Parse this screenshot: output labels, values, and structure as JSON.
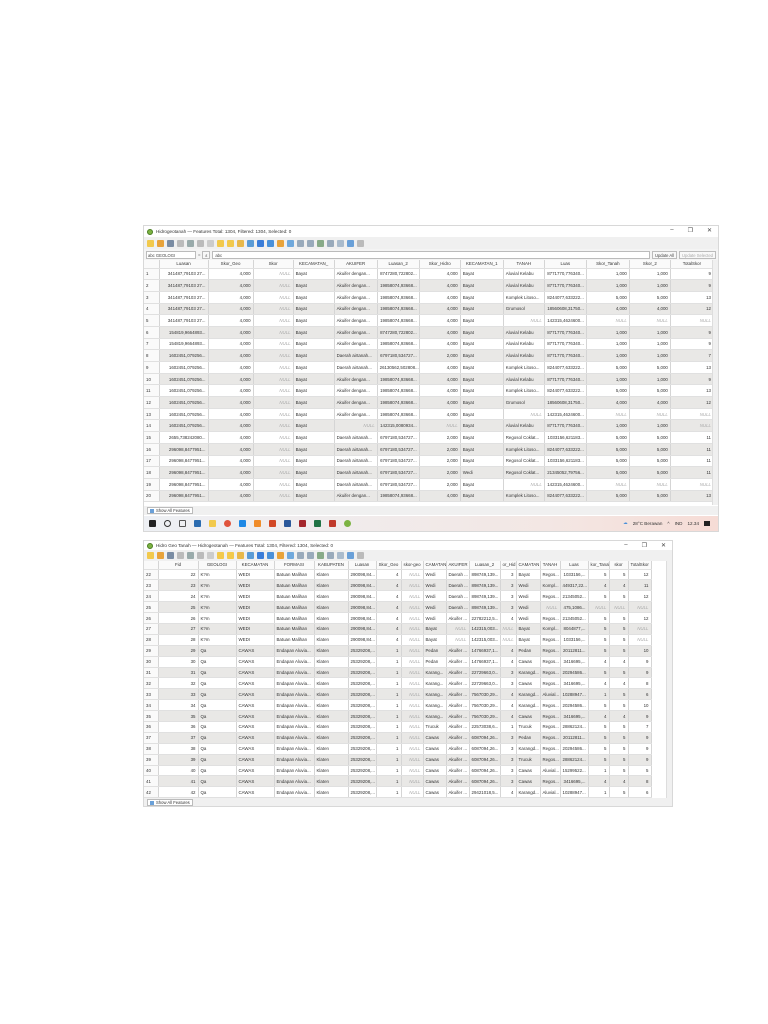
{
  "window1": {
    "title": "Hidrogeotanah — Features Total: 1304, Filtered: 1304, Selected: 0",
    "field_select": "abc GEOLOGI",
    "equals": "=",
    "epsilon": "ε",
    "expression": "abc",
    "update_all": "Update All",
    "update_selected": "Update Selected",
    "show_all": "Show All Features",
    "columns": [
      "",
      "Luasan",
      "Skor_Geo",
      "Skor",
      "KECAMATAN_",
      "AKUIFER",
      "Luasan_2",
      "Skor_Hidro",
      "KECAMATAN_1",
      "TANAH",
      "Luas",
      "Skor_Tanah",
      "Skor_2",
      "TotalSkor"
    ],
    "rows": [
      [
        "1",
        "341487,79103 27...",
        "4,000",
        "NULL",
        "Bayat",
        "Akuifer dengan...",
        "8747280,722802...",
        "4,000",
        "Bayat",
        "Aluvial Kelabu",
        "8771770,776340...",
        "1,000",
        "1,000",
        "9"
      ],
      [
        "2",
        "341487,79103 27...",
        "4,000",
        "NULL",
        "Bayat",
        "Akuifer dengan...",
        "19858074,93668...",
        "4,000",
        "Bayat",
        "Aluvial Kelabu",
        "8771770,776340...",
        "1,000",
        "1,000",
        "9"
      ],
      [
        "3",
        "341487,79103 27...",
        "4,000",
        "NULL",
        "Bayat",
        "Akuifer dengan...",
        "19858074,93668...",
        "4,000",
        "Bayat",
        "Komplek Litoso...",
        "8244077,633222...",
        "5,000",
        "5,000",
        "13"
      ],
      [
        "4",
        "341487,79103 27...",
        "4,000",
        "NULL",
        "Bayat",
        "Akuifer dengan...",
        "19858074,93668...",
        "4,000",
        "Bayat",
        "Grumosol",
        "18560608,31750...",
        "4,000",
        "4,000",
        "12"
      ],
      [
        "5",
        "341487,79103 27...",
        "4,000",
        "NULL",
        "Bayat",
        "Akuifer dengan...",
        "19858074,93668...",
        "4,000",
        "Bayat",
        "NULL",
        "142315,4624600...",
        "NULL",
        "NULL",
        "NULL"
      ],
      [
        "6",
        "154819,9664893...",
        "4,000",
        "NULL",
        "Bayat",
        "Akuifer dengan...",
        "8747280,722802...",
        "4,000",
        "Bayat",
        "Aluvial Kelabu",
        "8771770,776340...",
        "1,000",
        "1,000",
        "9"
      ],
      [
        "7",
        "154819,9664893...",
        "4,000",
        "NULL",
        "Bayat",
        "Akuifer dengan...",
        "19858074,93668...",
        "4,000",
        "Bayat",
        "Aluvial Kelabu",
        "8771770,776340...",
        "1,000",
        "1,000",
        "9"
      ],
      [
        "8",
        "1602451,079256...",
        "4,000",
        "NULL",
        "Bayat",
        "Daerah airtanah...",
        "6797180,534727...",
        "2,000",
        "Bayat",
        "Aluvial Kelabu",
        "8771770,776340...",
        "1,000",
        "1,000",
        "7"
      ],
      [
        "9",
        "1602451,079256...",
        "4,000",
        "NULL",
        "Bayat",
        "Daerah airtanah...",
        "26130562,502808...",
        "4,000",
        "Bayat",
        "Komplek Litoso...",
        "8244077,633222...",
        "5,000",
        "5,000",
        "13"
      ],
      [
        "10",
        "1602451,079256...",
        "4,000",
        "NULL",
        "Bayat",
        "Akuifer dengan...",
        "19858074,93668...",
        "4,000",
        "Bayat",
        "Aluvial Kelabu",
        "8771770,776340...",
        "1,000",
        "1,000",
        "9"
      ],
      [
        "11",
        "1602451,079256...",
        "4,000",
        "NULL",
        "Bayat",
        "Akuifer dengan...",
        "19858074,93668...",
        "4,000",
        "Bayat",
        "Komplek Litoso...",
        "8244077,633222...",
        "5,000",
        "5,000",
        "13"
      ],
      [
        "12",
        "1602451,079256...",
        "4,000",
        "NULL",
        "Bayat",
        "Akuifer dengan...",
        "19858074,93668...",
        "4,000",
        "Bayat",
        "Grumosol",
        "18560608,31750...",
        "4,000",
        "4,000",
        "12"
      ],
      [
        "13",
        "1602451,079256...",
        "4,000",
        "NULL",
        "Bayat",
        "Akuifer dengan...",
        "19858074,93668...",
        "4,000",
        "Bayat",
        "NULL",
        "142315,4624600...",
        "NULL",
        "NULL",
        "NULL"
      ],
      [
        "14",
        "1602451,079256...",
        "4,000",
        "NULL",
        "Bayat",
        "NULL",
        "142315,0080934...",
        "NULL",
        "Bayat",
        "Aluvial Kelabu",
        "8771770,776340...",
        "1,000",
        "1,000",
        "NULL"
      ],
      [
        "15",
        "2655,738242080...",
        "4,000",
        "NULL",
        "Bayat",
        "Daerah airtanah...",
        "6797180,534727...",
        "2,000",
        "Bayat",
        "Regosol Coklat...",
        "1033156,621183...",
        "5,000",
        "5,000",
        "11"
      ],
      [
        "16",
        "296098,8477951...",
        "4,000",
        "NULL",
        "Bayat",
        "Daerah airtanah...",
        "6797180,534727...",
        "2,000",
        "Bayat",
        "Komplek Litoso...",
        "8244077,633222...",
        "5,000",
        "5,000",
        "11"
      ],
      [
        "17",
        "296098,8477951...",
        "4,000",
        "NULL",
        "Bayat",
        "Daerah airtanah...",
        "6797180,534727...",
        "2,000",
        "Bayat",
        "Regosol Coklat...",
        "1033156,621183...",
        "5,000",
        "5,000",
        "11"
      ],
      [
        "18",
        "296098,8477951...",
        "4,000",
        "NULL",
        "Bayat",
        "Daerah airtanah...",
        "6797180,534727...",
        "2,000",
        "Wedi",
        "Regosol Coklat...",
        "21345052,79756...",
        "5,000",
        "5,000",
        "11"
      ],
      [
        "19",
        "296098,8477951...",
        "4,000",
        "NULL",
        "Bayat",
        "Daerah airtanah...",
        "6797180,534727...",
        "2,000",
        "Bayat",
        "NULL",
        "142315,4624600...",
        "NULL",
        "NULL",
        "NULL"
      ],
      [
        "20",
        "296098,8477951...",
        "4,000",
        "NULL",
        "Bayat",
        "Akuifer dengan...",
        "19858074,93668...",
        "4,000",
        "Bayat",
        "Komplek Litoso...",
        "8244077,633222...",
        "5,000",
        "5,000",
        "13"
      ]
    ],
    "taskbar": {
      "weather": "28°C Berawan",
      "lang": "IND",
      "time": "12.34"
    }
  },
  "window2": {
    "title": "Hidro Geo Tanah — Hidrogeotanah — Features Total: 1304, Filtered: 1304, Selected: 0",
    "show_all": "Show All Features",
    "columns": [
      "",
      "Fid",
      "GEOLOGI",
      "KECAMATAN",
      "FORMASI",
      "KABUPATEN",
      "Luasan",
      "Skor_Geo",
      "skor-geo",
      "CAMATAN",
      "AKUIFER",
      "Luasan_2",
      "or_Hid",
      "CAMATAN",
      "TANAH",
      "Luas",
      "kor_Tanah",
      "skor",
      "TotalSkor"
    ],
    "rows": [
      [
        "22",
        "22",
        "K?m",
        "WEDI",
        "Batuan Malihan",
        "Klaten",
        "290098,84...",
        "4",
        "NULL",
        "Wedi",
        "Daerah ...",
        "898749,139...",
        "3",
        "Bayat",
        "Regos...",
        "1033156,...",
        "5",
        "5",
        "12"
      ],
      [
        "23",
        "23",
        "K?m",
        "WEDI",
        "Batuan Malihan",
        "Klaten",
        "290098,84...",
        "4",
        "NULL",
        "Wedi",
        "Daerah ...",
        "898749,139...",
        "3",
        "Wedi",
        "Kompl...",
        "449317,22...",
        "4",
        "4",
        "11"
      ],
      [
        "24",
        "24",
        "K?m",
        "WEDI",
        "Batuan Malihan",
        "Klaten",
        "290098,84...",
        "4",
        "NULL",
        "Wedi",
        "Daerah ...",
        "898749,139...",
        "3",
        "Wedi",
        "Regos...",
        "21345052...",
        "5",
        "5",
        "12"
      ],
      [
        "25",
        "25",
        "K?m",
        "WEDI",
        "Batuan Malihan",
        "Klaten",
        "290098,84...",
        "4",
        "NULL",
        "Wedi",
        "Daerah ...",
        "898749,139...",
        "3",
        "Wedi",
        "NULL",
        "475,1086...",
        "NULL",
        "NULL",
        "NULL"
      ],
      [
        "26",
        "26",
        "K?m",
        "WEDI",
        "Batuan Malihan",
        "Klaten",
        "290098,84...",
        "4",
        "NULL",
        "Wedi",
        "Akuifer ...",
        "22782212,5...",
        "4",
        "Wedi",
        "Regos...",
        "21345052...",
        "5",
        "5",
        "12"
      ],
      [
        "27",
        "27",
        "K?m",
        "WEDI",
        "Batuan Malihan",
        "Klaten",
        "290098,84...",
        "4",
        "NULL",
        "Bayat",
        "NULL",
        "142315,003...",
        "NULL",
        "Bayat",
        "Kompl...",
        "8044877,...",
        "5",
        "5",
        "NULL"
      ],
      [
        "28",
        "28",
        "K?m",
        "WEDI",
        "Batuan Malihan",
        "Klaten",
        "290098,84...",
        "4",
        "NULL",
        "Bayat",
        "NULL",
        "142315,003...",
        "NULL",
        "Bayat",
        "Regos...",
        "1033156,...",
        "5",
        "5",
        "NULL"
      ],
      [
        "29",
        "29",
        "Qa",
        "CAWAS",
        "Endapan Aluvia...",
        "Klaten",
        "25329208,...",
        "1",
        "NULL",
        "Pedan",
        "Akuifer ...",
        "14766937,1...",
        "4",
        "Pedan",
        "Regos...",
        "20112811...",
        "5",
        "5",
        "10"
      ],
      [
        "30",
        "30",
        "Qa",
        "CAWAS",
        "Endapan Aluvia...",
        "Klaten",
        "25329208,...",
        "1",
        "NULL",
        "Pedan",
        "Akuifer ...",
        "14766937,1...",
        "4",
        "Cawas",
        "Regos...",
        "3416695,...",
        "4",
        "4",
        "9"
      ],
      [
        "31",
        "31",
        "Qa",
        "CAWAS",
        "Endapan Aluvia...",
        "Klaten",
        "25329208,...",
        "1",
        "NULL",
        "Karang...",
        "Akuifer ...",
        "22729663,0...",
        "3",
        "Karangd...",
        "Regos...",
        "20294586...",
        "5",
        "5",
        "9"
      ],
      [
        "32",
        "32",
        "Qa",
        "CAWAS",
        "Endapan Aluvia...",
        "Klaten",
        "25329208,...",
        "1",
        "NULL",
        "Karang...",
        "Akuifer ...",
        "22729663,0...",
        "3",
        "Cawas",
        "Regos...",
        "3416695,...",
        "4",
        "4",
        "8"
      ],
      [
        "33",
        "33",
        "Qa",
        "CAWAS",
        "Endapan Aluvia...",
        "Klaten",
        "25329208,...",
        "1",
        "NULL",
        "Karang...",
        "Akuifer ...",
        "7567030,29...",
        "4",
        "Karangd...",
        "Aluvial...",
        "10288947...",
        "1",
        "5",
        "6"
      ],
      [
        "34",
        "34",
        "Qa",
        "CAWAS",
        "Endapan Aluvia...",
        "Klaten",
        "25329208,...",
        "1",
        "NULL",
        "Karang...",
        "Akuifer ...",
        "7567030,29...",
        "4",
        "Karangd...",
        "Regos...",
        "20294586...",
        "5",
        "5",
        "10"
      ],
      [
        "35",
        "35",
        "Qa",
        "CAWAS",
        "Endapan Aluvia...",
        "Klaten",
        "25329208,...",
        "1",
        "NULL",
        "Karang...",
        "Akuifer ...",
        "7567030,29...",
        "4",
        "Cawas",
        "Regos...",
        "3416695,...",
        "4",
        "4",
        "9"
      ],
      [
        "36",
        "36",
        "Qa",
        "CAWAS",
        "Endapan Aluvia...",
        "Klaten",
        "25329208,...",
        "1",
        "NULL",
        "Trucuk",
        "Akuifer ...",
        "22573038,6...",
        "1",
        "Trucuk",
        "Regos...",
        "28862124...",
        "5",
        "5",
        "7"
      ],
      [
        "37",
        "37",
        "Qa",
        "CAWAS",
        "Endapan Aluvia...",
        "Klaten",
        "25329208,...",
        "1",
        "NULL",
        "Cawas",
        "Akuifer ...",
        "6087094,26...",
        "3",
        "Pedan",
        "Regos...",
        "20112811...",
        "5",
        "5",
        "9"
      ],
      [
        "38",
        "38",
        "Qa",
        "CAWAS",
        "Endapan Aluvia...",
        "Klaten",
        "25329208,...",
        "1",
        "NULL",
        "Cawas",
        "Akuifer ...",
        "6087094,26...",
        "3",
        "Karangd...",
        "Regos...",
        "20294586...",
        "5",
        "5",
        "9"
      ],
      [
        "39",
        "39",
        "Qa",
        "CAWAS",
        "Endapan Aluvia...",
        "Klaten",
        "25329208,...",
        "1",
        "NULL",
        "Cawas",
        "Akuifer ...",
        "6087094,26...",
        "3",
        "Trucuk",
        "Regos...",
        "28862124...",
        "5",
        "5",
        "9"
      ],
      [
        "40",
        "40",
        "Qa",
        "CAWAS",
        "Endapan Aluvia...",
        "Klaten",
        "25329208,...",
        "1",
        "NULL",
        "Cawas",
        "Akuifer ...",
        "6087094,26...",
        "3",
        "Cawas",
        "Aluvial...",
        "15299522...",
        "1",
        "5",
        "5"
      ],
      [
        "41",
        "41",
        "Qa",
        "CAWAS",
        "Endapan Aluvia...",
        "Klaten",
        "25329208,...",
        "1",
        "NULL",
        "Cawas",
        "Akuifer ...",
        "6087094,26...",
        "3",
        "Cawas",
        "Regos...",
        "3416695,...",
        "4",
        "4",
        "8"
      ],
      [
        "42",
        "42",
        "Qa",
        "CAWAS",
        "Endapan Aluvia...",
        "Klaten",
        "25329208,...",
        "1",
        "NULL",
        "Cawas",
        "Akuifer ...",
        "29421018,5...",
        "4",
        "Karangd...",
        "Aluvial...",
        "10288947...",
        "1",
        "5",
        "6"
      ]
    ]
  }
}
